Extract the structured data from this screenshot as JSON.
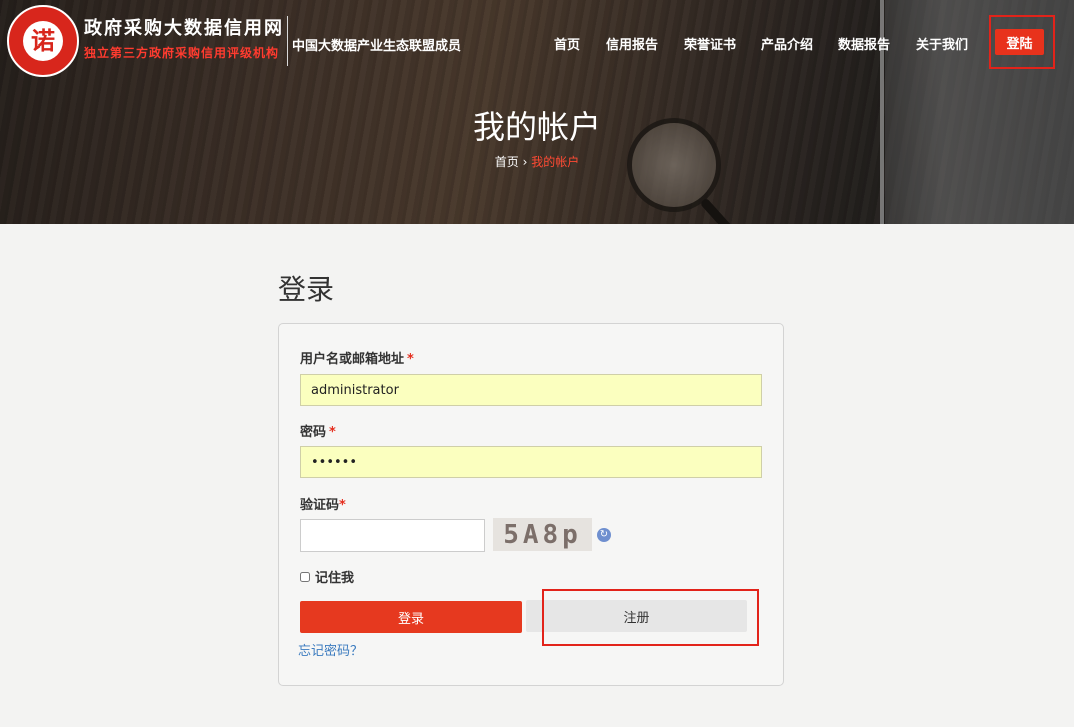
{
  "header": {
    "logo_mark": "诺",
    "site_title": "政府采购大数据信用网",
    "site_tagline": "独立第三方政府采购信用评级机构",
    "alliance": "中国大数据产业生态联盟成员",
    "nav": [
      {
        "label": "首页"
      },
      {
        "label": "信用报告"
      },
      {
        "label": "荣誉证书"
      },
      {
        "label": "产品介绍"
      },
      {
        "label": "数据报告"
      },
      {
        "label": "关于我们"
      }
    ],
    "login_label": "登陆",
    "page_heading": "我的帐户",
    "breadcrumb": {
      "home": "首页",
      "separator": "›",
      "current": "我的帐户"
    }
  },
  "login_form": {
    "title": "登录",
    "username_label": "用户名或邮箱地址",
    "username_value": "administrator",
    "password_label": "密码",
    "password_value": "••••••",
    "captcha_label": "验证码",
    "captcha_text": "5A8p",
    "captcha_value": "",
    "required_mark": "*",
    "remember_label": "记住我",
    "remember_checked": false,
    "login_button": "登录",
    "register_button": "注册",
    "forgot_link": "忘记密码？"
  },
  "colors": {
    "accent": "#e6391f",
    "highlight_box": "#e2231a",
    "autofill_bg": "#fbffbf",
    "link": "#3b7bbf"
  }
}
